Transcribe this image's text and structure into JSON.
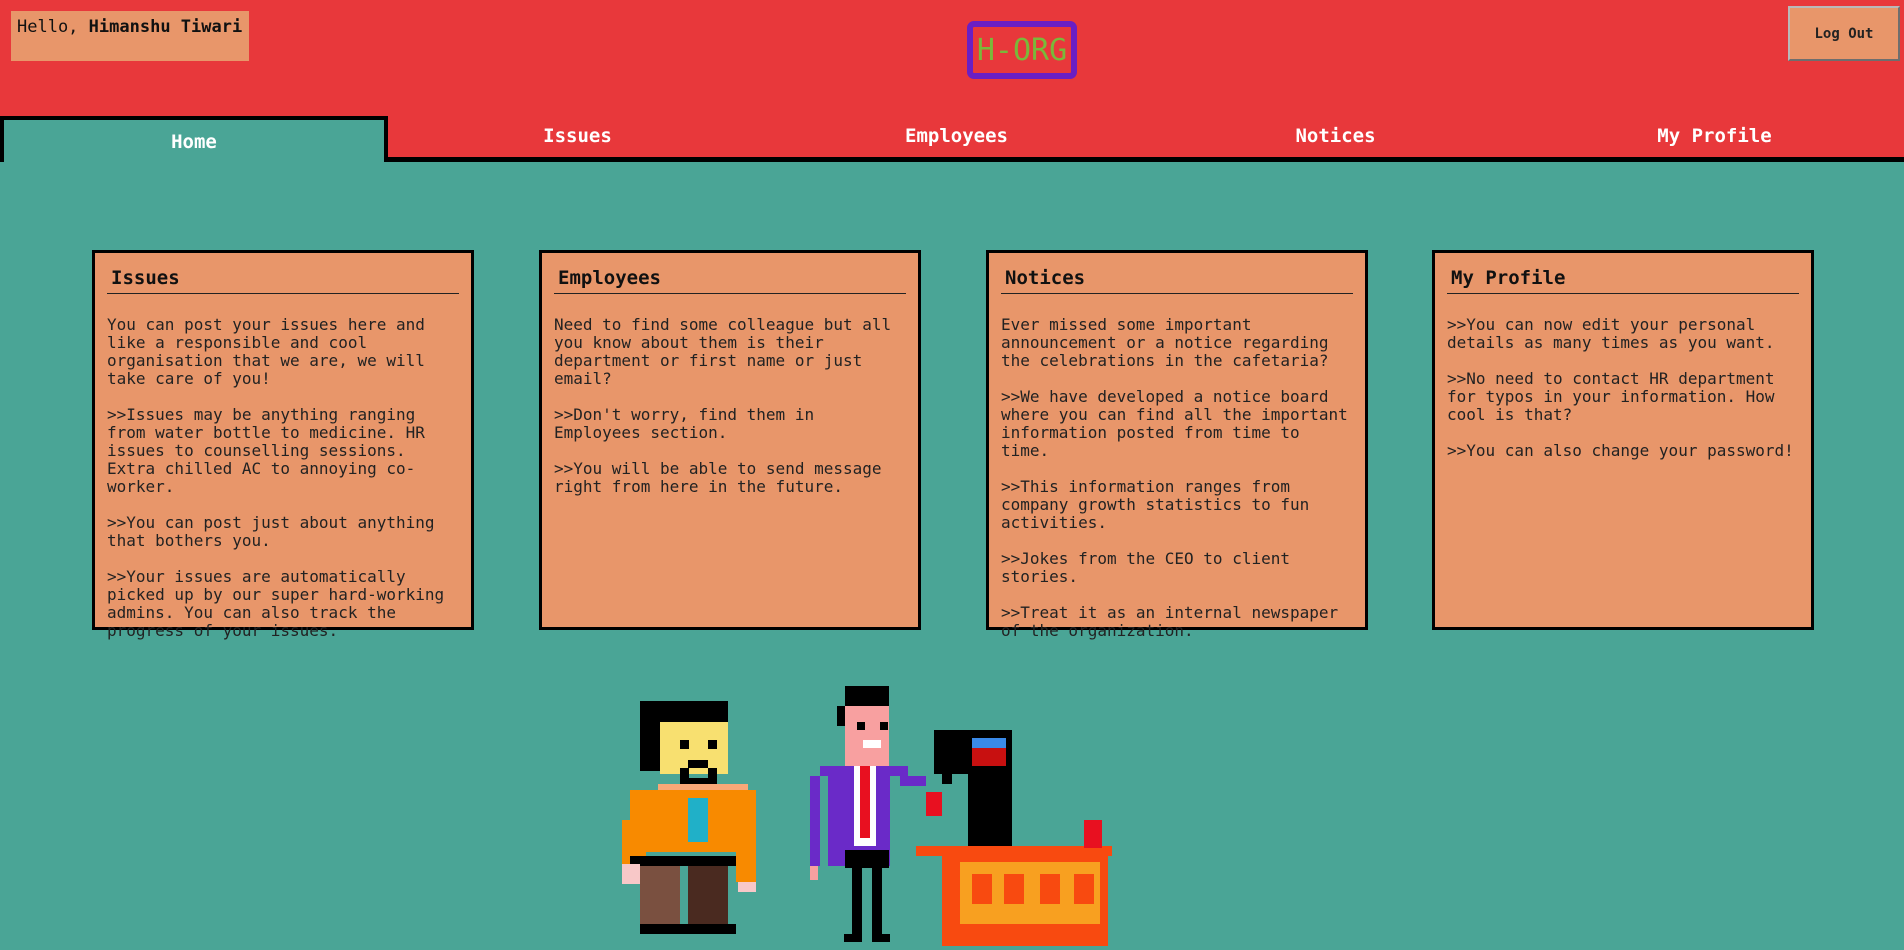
{
  "header": {
    "greeting_prefix": "Hello,",
    "user_name": "Himanshu Tiwari",
    "logo_text": "H-ORG",
    "logout_label": "Log Out"
  },
  "tabs": [
    {
      "label": "Home",
      "active": true
    },
    {
      "label": "Issues",
      "active": false
    },
    {
      "label": "Employees",
      "active": false
    },
    {
      "label": "Notices",
      "active": false
    },
    {
      "label": "My Profile",
      "active": false
    }
  ],
  "cards": [
    {
      "title": "Issues",
      "paragraphs": [
        "You can post your issues here and like a responsible and cool organisation that we are, we will take care of you!",
        ">>Issues may be anything ranging from water bottle to medicine. HR issues to counselling sessions. Extra chilled AC to annoying co-worker.",
        ">>You can post just about anything that bothers you.",
        ">>Your issues are automatically picked up by our super hard-working admins. You can also track the progress of your issues."
      ]
    },
    {
      "title": "Employees",
      "paragraphs": [
        "Need to find some colleague but all you know about them is their department or first name or just email?",
        ">>Don't worry, find them in Employees section.",
        ">>You will be able to send message right from here in the future."
      ]
    },
    {
      "title": "Notices",
      "paragraphs": [
        "Ever missed some important announcement or a notice regarding the celebrations in the cafetaria?",
        ">>We have developed a notice board where you can find all the important information posted from time to time.",
        ">>This information ranges from company growth statistics to fun activities.",
        ">>Jokes from the CEO to client stories.",
        ">>Treat it as an internal newspaper of the organization."
      ]
    },
    {
      "title": "My Profile",
      "paragraphs": [
        ">>You can now edit your personal details as many times as you want.",
        ">>No need to contact HR department for typos in your information. How cool is that?",
        ">>You can also change your password!"
      ]
    }
  ],
  "colors": {
    "header_bg": "#e8383b",
    "page_bg": "#4aa596",
    "card_bg": "#e8966a",
    "logo_border": "#6a1fc4",
    "logo_text": "#7ab83a"
  },
  "illustration": "pixel-art-office-workers"
}
